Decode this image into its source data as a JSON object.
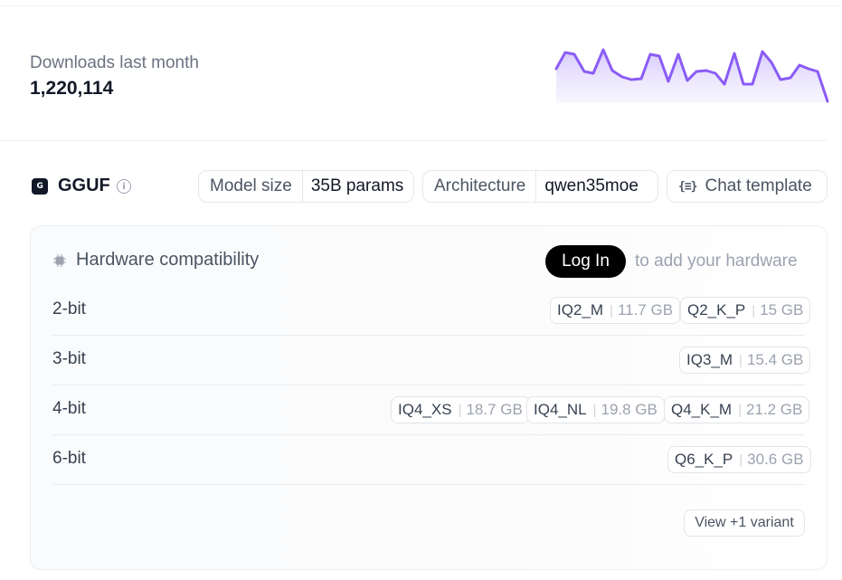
{
  "downloads": {
    "label": "Downloads last month",
    "value": "1,220,114",
    "sparkline_color": "#8b5cf6"
  },
  "gguf": {
    "title": "GGUF",
    "icon": "gguf-icon",
    "icon_text": "G",
    "info_icon": "info-icon",
    "info_glyph": "i"
  },
  "meta": {
    "model_size_label": "Model size",
    "model_size_value": "35B params",
    "architecture_label": "Architecture",
    "architecture_value": "qwen35moe",
    "chat_template_icon": "{≡}",
    "chat_template_label": "Chat template"
  },
  "hardware": {
    "title": "Hardware compatibility",
    "login_label": "Log In",
    "login_note": "to add your hardware",
    "rows": [
      {
        "label": "2-bit",
        "quants": [
          {
            "name": "IQ2_M",
            "size": "11.7 GB"
          },
          {
            "name": "Q2_K_P",
            "size": "15 GB"
          }
        ]
      },
      {
        "label": "3-bit",
        "quants": [
          {
            "name": "IQ3_M",
            "size": "15.4 GB"
          }
        ]
      },
      {
        "label": "4-bit",
        "quants": [
          {
            "name": "IQ4_XS",
            "size": "18.7 GB"
          },
          {
            "name": "IQ4_NL",
            "size": "19.8 GB"
          },
          {
            "name": "Q4_K_M",
            "size": "21.2 GB"
          }
        ]
      },
      {
        "label": "6-bit",
        "quants": [
          {
            "name": "Q6_K_P",
            "size": "30.6 GB"
          }
        ]
      }
    ],
    "separator": "|",
    "view_variants_label": "View +1 variant"
  }
}
